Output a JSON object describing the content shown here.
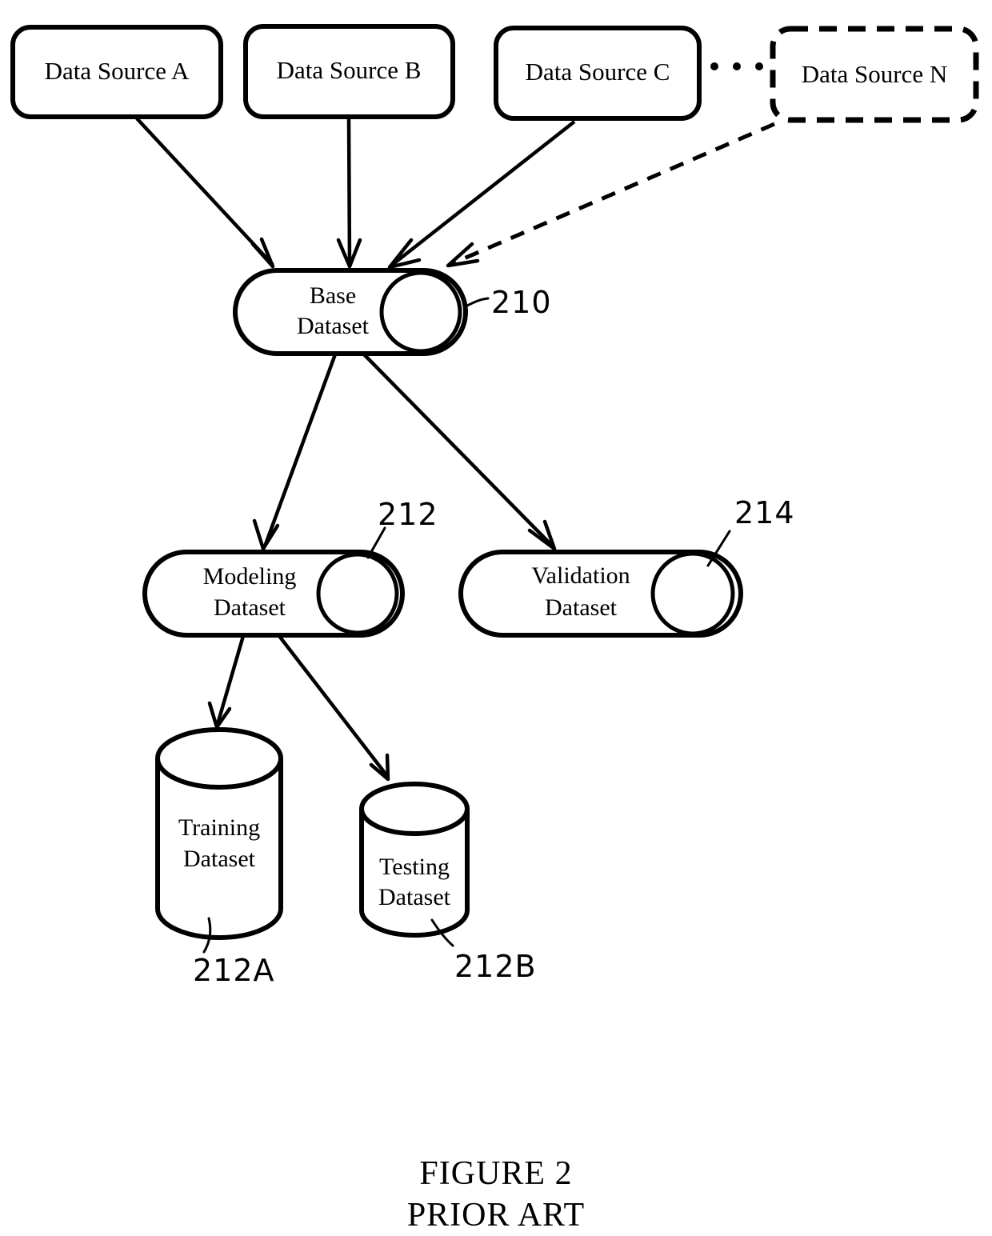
{
  "figure": {
    "caption_line1": "FIGURE 2",
    "caption_line2": "PRIOR ART"
  },
  "diagram": {
    "type": "flowchart",
    "sources": [
      {
        "id": "source-a",
        "label": "Data Source A",
        "style": "solid"
      },
      {
        "id": "source-b",
        "label": "Data Source B",
        "style": "solid"
      },
      {
        "id": "source-c",
        "label": "Data Source C",
        "style": "solid"
      },
      {
        "id": "source-n",
        "label": "Data Source N",
        "style": "dashed"
      }
    ],
    "ellipsis": "• • •",
    "datasets": [
      {
        "id": "base-dataset",
        "label_line1": "Base",
        "label_line2": "Dataset",
        "ref": "210",
        "shape": "horizontal-cylinder"
      },
      {
        "id": "modeling-dataset",
        "label_line1": "Modeling",
        "label_line2": "Dataset",
        "ref": "212",
        "shape": "horizontal-cylinder"
      },
      {
        "id": "validation-dataset",
        "label_line1": "Validation",
        "label_line2": "Dataset",
        "ref": "214",
        "shape": "horizontal-cylinder"
      },
      {
        "id": "training-dataset",
        "label_line1": "Training",
        "label_line2": "Dataset",
        "ref": "212A",
        "shape": "vertical-cylinder"
      },
      {
        "id": "testing-dataset",
        "label_line1": "Testing",
        "label_line2": "Dataset",
        "ref": "212B",
        "shape": "vertical-cylinder"
      }
    ],
    "edges": [
      {
        "from": "source-a",
        "to": "base-dataset",
        "style": "solid"
      },
      {
        "from": "source-b",
        "to": "base-dataset",
        "style": "solid"
      },
      {
        "from": "source-c",
        "to": "base-dataset",
        "style": "solid"
      },
      {
        "from": "source-n",
        "to": "base-dataset",
        "style": "dashed"
      },
      {
        "from": "base-dataset",
        "to": "modeling-dataset",
        "style": "solid"
      },
      {
        "from": "base-dataset",
        "to": "validation-dataset",
        "style": "solid"
      },
      {
        "from": "modeling-dataset",
        "to": "training-dataset",
        "style": "solid"
      },
      {
        "from": "modeling-dataset",
        "to": "testing-dataset",
        "style": "solid"
      }
    ]
  },
  "colors": {
    "ink": "#000000",
    "paper": "#ffffff"
  }
}
